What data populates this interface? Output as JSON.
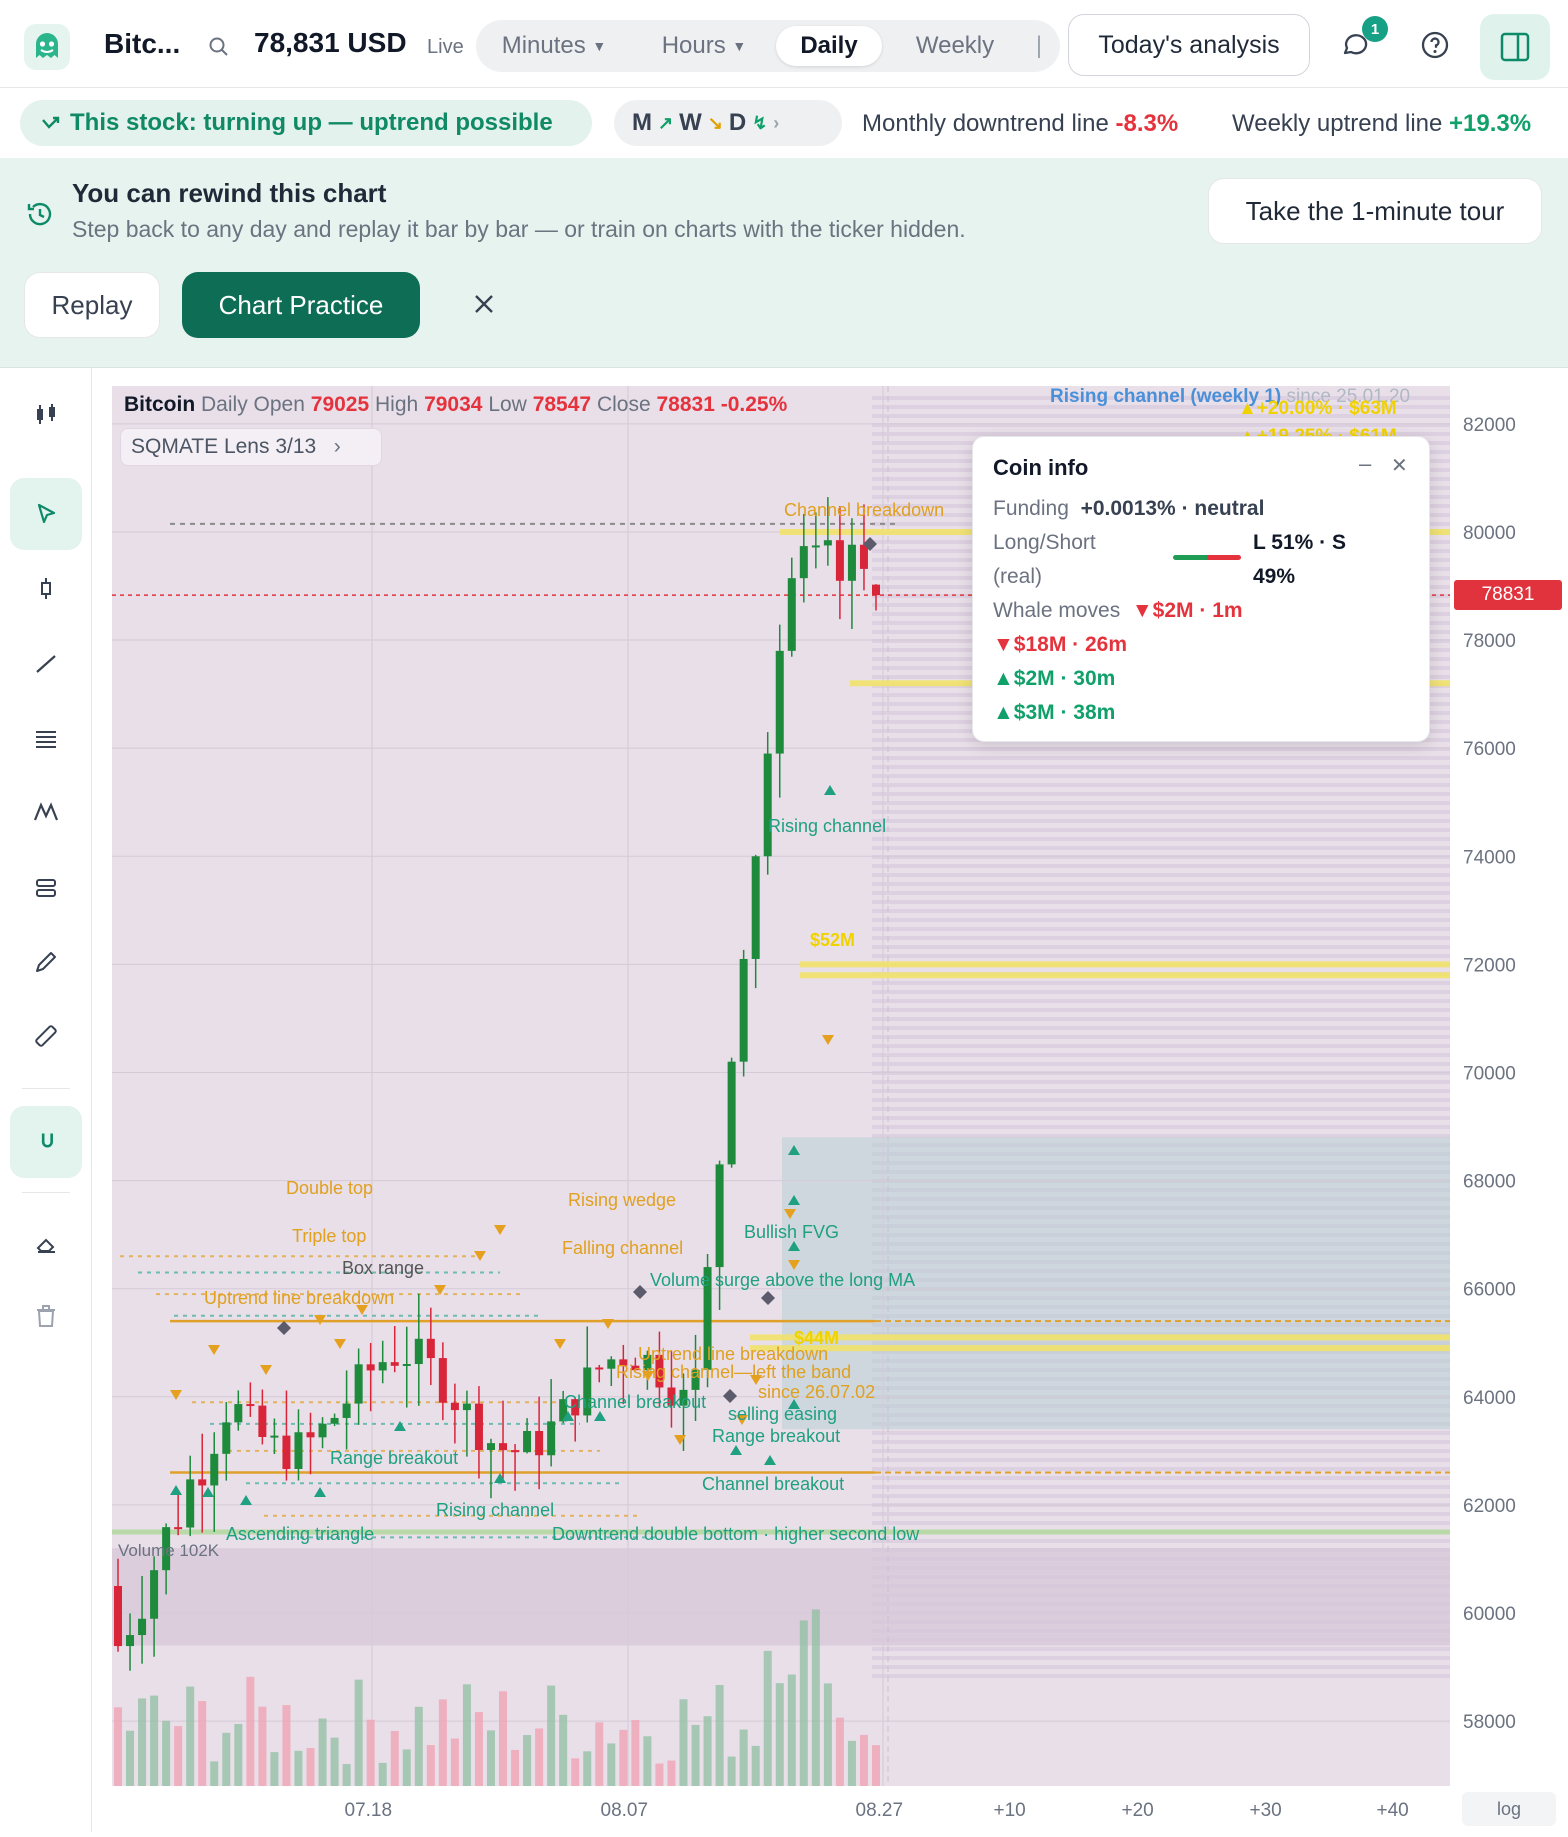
{
  "header": {
    "symbol": "Bitc...",
    "price": "78,831 USD",
    "live": "Live",
    "tabs": [
      {
        "label": "Minutes"
      },
      {
        "label": "Hours"
      },
      {
        "label": "Daily"
      },
      {
        "label": "Weekly"
      }
    ],
    "analysis_button": "Today's analysis",
    "chat_badge": "1"
  },
  "trend": {
    "pill": "This stock: turning up — uptrend possible",
    "mwd": [
      "M",
      "W",
      "D"
    ],
    "monthly_label": "Monthly downtrend line",
    "monthly_value": "-8.3%",
    "weekly_label": "Weekly uptrend line",
    "weekly_value": "+19.3%"
  },
  "banner": {
    "title": "You can rewind this chart",
    "subtitle": "Step back to any day and replay it bar by bar — or train on charts with the ticker hidden.",
    "tour_button": "Take the 1-minute tour",
    "replay_button": "Replay",
    "practice_button": "Chart Practice"
  },
  "legend": {
    "name": "Bitcoin",
    "period": "Daily",
    "open_label": "Open",
    "open": "79025",
    "high_label": "High",
    "high": "79034",
    "low_label": "Low",
    "low": "78547",
    "close_label": "Close",
    "close": "78831",
    "change": "-0.25%",
    "lens": "SQMATE Lens  3/13",
    "channel_note": "Rising channel (weekly 1)",
    "channel_since": "since 25.01.20",
    "top_tag1": "▲+20.00% · $63M",
    "top_tag2": "▲+19.25% · $61M"
  },
  "coin_info": {
    "title": "Coin info",
    "funding_label": "Funding",
    "funding_value": "+0.0013% · neutral",
    "ls_label": "Long/Short",
    "ls_real": "(real)",
    "ls_value": "L 51% · S",
    "ls_value2": "49%",
    "whale_label": "Whale moves",
    "whale1": "▼$2M · 1m",
    "whale2": "▼$18M · 26m",
    "whale3": "▲$2M · 30m",
    "whale4": "▲$3M · 38m"
  },
  "price_label": "78831",
  "chart_data": {
    "type": "candlestick",
    "y_axis": [
      82000,
      80000,
      78000,
      76000,
      74000,
      72000,
      70000,
      68000,
      66000,
      64000,
      62000,
      60000,
      58000
    ],
    "x_axis": [
      "07.18",
      "08.07",
      "08.27",
      "+10",
      "+20",
      "+30",
      "+40"
    ],
    "ylim": [
      56800,
      82700
    ],
    "scale": "log",
    "volume_label": "Volume 102K",
    "current_price": 78831,
    "last_bar": {
      "open": 79025,
      "high": 79034,
      "low": 78547,
      "close": 78831
    }
  },
  "patterns": [
    {
      "label": "Channel breakdown"
    },
    {
      "label": "Rising channel"
    },
    {
      "label": "$52M"
    },
    {
      "label": "Bullish FVG"
    },
    {
      "label": "$44M"
    },
    {
      "label": "Double top"
    },
    {
      "label": "Triple top"
    },
    {
      "label": "Box range"
    },
    {
      "label": "Uptrend line breakdown"
    },
    {
      "label": "Rising wedge"
    },
    {
      "label": "Falling channel"
    },
    {
      "label": "Volume surge above the long MA"
    },
    {
      "label": "Uptrend line breakdown"
    },
    {
      "label": "Rising channel—left the band"
    },
    {
      "label": "since 26.07.02"
    },
    {
      "label": "Channel breakout"
    },
    {
      "label": "selling easing"
    },
    {
      "label": "Range breakout"
    },
    {
      "label": "Range breakout"
    },
    {
      "label": "Channel breakout"
    },
    {
      "label": "Rising channel"
    },
    {
      "label": "Ascending triangle"
    },
    {
      "label": "Downtrend double bottom · higher second low"
    }
  ],
  "log_button": "log"
}
